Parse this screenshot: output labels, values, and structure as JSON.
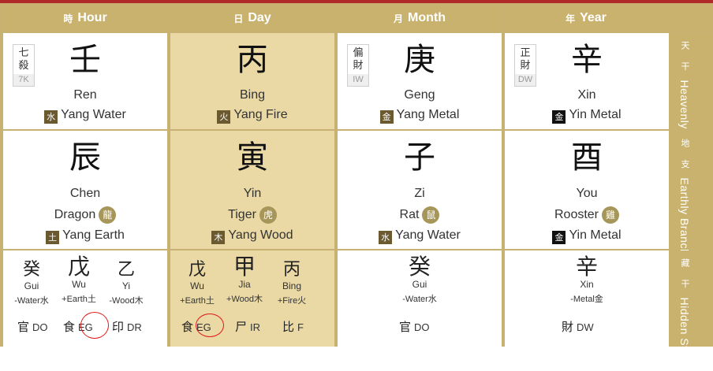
{
  "headers": {
    "hour": {
      "zh": "時",
      "label": "Hour"
    },
    "day": {
      "zh": "日",
      "label": "Day"
    },
    "month": {
      "zh": "月",
      "label": "Month"
    },
    "year": {
      "zh": "年",
      "label": "Year"
    }
  },
  "side_labels": {
    "stems": {
      "zh": "天 干",
      "en": "Heavenly Stems"
    },
    "branches": {
      "zh": "地 支",
      "en": "Earthly Branches"
    },
    "hidden": {
      "zh": "藏 干",
      "en": "Hidden Stems"
    }
  },
  "stems": {
    "hour": {
      "char": "壬",
      "pinyin": "Ren",
      "elem_char": "水",
      "element": "Yang Water",
      "badge_zh": "七殺",
      "badge_code": "7K"
    },
    "day": {
      "char": "丙",
      "pinyin": "Bing",
      "elem_char": "火",
      "element": "Yang Fire"
    },
    "month": {
      "char": "庚",
      "pinyin": "Geng",
      "elem_char": "金",
      "element": "Yang Metal",
      "badge_zh": "偏財",
      "badge_code": "IW"
    },
    "year": {
      "char": "辛",
      "pinyin": "Xin",
      "elem_char": "金",
      "element": "Yin Metal",
      "badge_zh": "正財",
      "badge_code": "DW"
    }
  },
  "branches": {
    "hour": {
      "char": "辰",
      "pinyin": "Chen",
      "animal": "Dragon",
      "animal_char": "龍",
      "elem_char": "土",
      "element": "Yang Earth"
    },
    "day": {
      "char": "寅",
      "pinyin": "Yin",
      "animal": "Tiger",
      "animal_char": "虎",
      "elem_char": "木",
      "element": "Yang Wood"
    },
    "month": {
      "char": "子",
      "pinyin": "Zi",
      "animal": "Rat",
      "animal_char": "鼠",
      "elem_char": "水",
      "element": "Yang Water"
    },
    "year": {
      "char": "酉",
      "pinyin": "You",
      "animal": "Rooster",
      "animal_char": "雞",
      "elem_char": "金",
      "element": "Yin Metal"
    }
  },
  "hidden": {
    "hour": [
      {
        "char": "癸",
        "pinyin": "Gui",
        "element": "-Water水",
        "god_zh": "官",
        "god": "DO"
      },
      {
        "char": "戊",
        "pinyin": "Wu",
        "element": "+Earth土",
        "god_zh": "食",
        "god": "EG"
      },
      {
        "char": "乙",
        "pinyin": "Yi",
        "element": "-Wood木",
        "god_zh": "印",
        "god": "DR"
      }
    ],
    "day": [
      {
        "char": "戊",
        "pinyin": "Wu",
        "element": "+Earth土",
        "god_zh": "食",
        "god": "EG"
      },
      {
        "char": "甲",
        "pinyin": "Jia",
        "element": "+Wood木",
        "god_zh": "尸",
        "god": "IR"
      },
      {
        "char": "丙",
        "pinyin": "Bing",
        "element": "+Fire火",
        "god_zh": "比",
        "god": "F"
      }
    ],
    "month": [
      {
        "char": "癸",
        "pinyin": "Gui",
        "element": "-Water水",
        "god_zh": "官",
        "god": "DO"
      }
    ],
    "year": [
      {
        "char": "辛",
        "pinyin": "Xin",
        "element": "-Metal金",
        "god_zh": "財",
        "god": "DW"
      }
    ]
  },
  "colors": {
    "header_gold": "#c9b26e",
    "day_column": "#ead9a4",
    "annotation_red": "#e01818"
  }
}
